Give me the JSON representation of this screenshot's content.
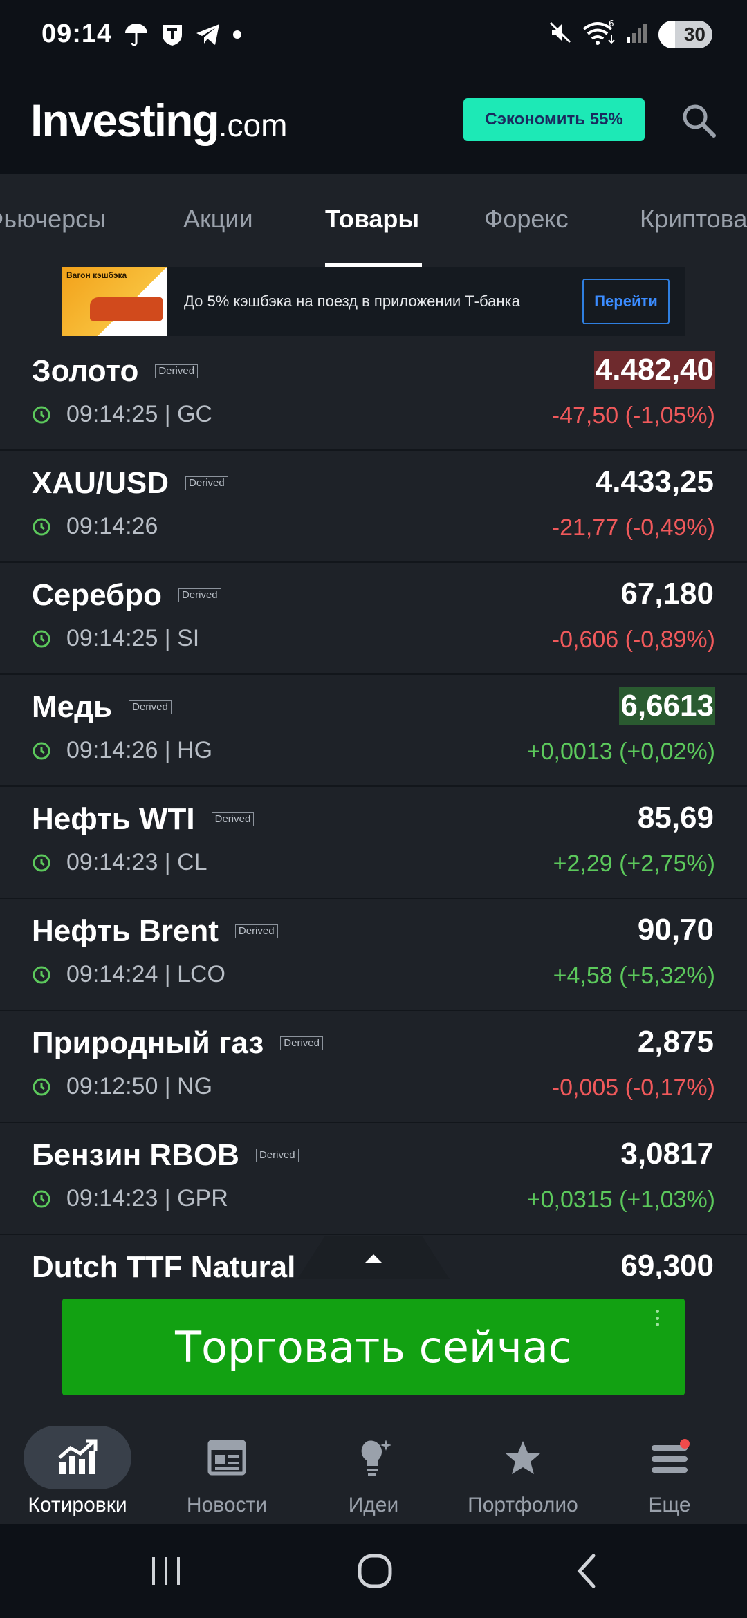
{
  "status_bar": {
    "time": "09:14",
    "battery": "30"
  },
  "header": {
    "logo_main": "Investing",
    "logo_suffix": ".com",
    "promo_label": "Сэкономить 55%"
  },
  "tabs": [
    {
      "label": "Фьючерсы"
    },
    {
      "label": "Акции"
    },
    {
      "label": "Товары",
      "active": true
    },
    {
      "label": "Форекс"
    },
    {
      "label": "Криптовалюта"
    }
  ],
  "ad": {
    "image_caption": "Вагон кэшбэка",
    "text": "До 5% кэшбэка на поезд в приложении Т-банка",
    "button": "Перейти"
  },
  "derived_badge": "Derived",
  "quotes": [
    {
      "name": "Золото",
      "time": "09:14:25 | GC",
      "price": "4.482,40",
      "change": "-47,50 (-1,05%)",
      "direction": "down",
      "highlight": "red"
    },
    {
      "name": "XAU/USD",
      "time": "09:14:26",
      "price": "4.433,25",
      "change": "-21,77 (-0,49%)",
      "direction": "down"
    },
    {
      "name": "Серебро",
      "time": "09:14:25 | SI",
      "price": "67,180",
      "change": "-0,606 (-0,89%)",
      "direction": "down"
    },
    {
      "name": "Медь",
      "time": "09:14:26 | HG",
      "price": "6,6613",
      "change": "+0,0013 (+0,02%)",
      "direction": "up",
      "highlight": "green"
    },
    {
      "name": "Нефть WTI",
      "time": "09:14:23 | CL",
      "price": "85,69",
      "change": "+2,29 (+2,75%)",
      "direction": "up"
    },
    {
      "name": "Нефть Brent",
      "time": "09:14:24 | LCO",
      "price": "90,70",
      "change": "+4,58 (+5,32%)",
      "direction": "up"
    },
    {
      "name": "Природный газ",
      "time": "09:12:50 | NG",
      "price": "2,875",
      "change": "-0,005 (-0,17%)",
      "direction": "down"
    },
    {
      "name": "Бензин RBOB",
      "time": "09:14:23 | GPR",
      "price": "3,0817",
      "change": "+0,0315 (+1,03%)",
      "direction": "up"
    },
    {
      "name": "Dutch TTF Natural",
      "time": "",
      "price": "69,300",
      "change": "",
      "direction": "up"
    }
  ],
  "trade_button": "Торговать сейчас",
  "bottom_nav": [
    {
      "label": "Котировки",
      "icon": "chart-icon",
      "active": true
    },
    {
      "label": "Новости",
      "icon": "news-icon"
    },
    {
      "label": "Идеи",
      "icon": "lightbulb-icon"
    },
    {
      "label": "Портфолио",
      "icon": "star-icon"
    },
    {
      "label": "Еще",
      "icon": "menu-icon"
    }
  ],
  "colors": {
    "negative": "#f0595b",
    "positive": "#5cc95c",
    "promo": "#1de9b6",
    "trade": "#12a112"
  }
}
